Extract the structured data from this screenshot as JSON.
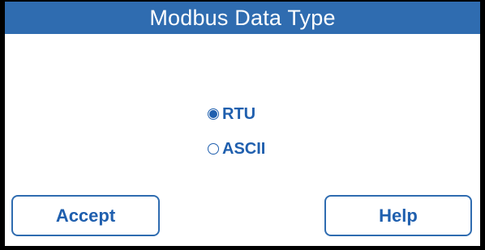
{
  "header": {
    "title": "Modbus Data Type"
  },
  "options": [
    {
      "label": "RTU",
      "selected": true
    },
    {
      "label": "ASCII",
      "selected": false
    }
  ],
  "buttons": {
    "accept_label": "Accept",
    "help_label": "Help"
  },
  "colors": {
    "header_bg": "#2f6cb0",
    "accent": "#1f5fae",
    "frame": "#000000",
    "panel_bg": "#ffffff"
  }
}
